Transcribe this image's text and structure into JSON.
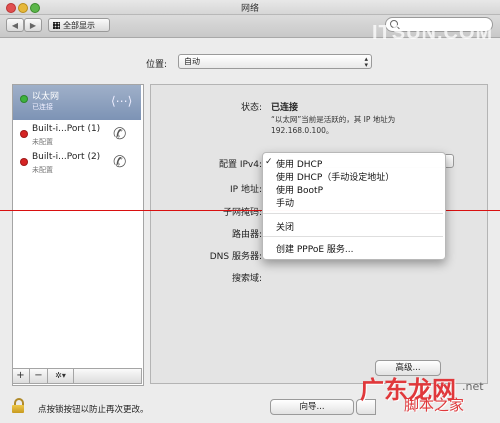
{
  "window": {
    "title": "网络"
  },
  "toolbar": {
    "back": "◀",
    "forward": "▶",
    "show_all": "全部显示",
    "search_placeholder": ""
  },
  "watermark": {
    "top": "ITSUN.COM",
    "logo": "广东龙网",
    "sub": "脚本之家",
    "net": ".net"
  },
  "location": {
    "label": "位置:",
    "value": "自动"
  },
  "services": [
    {
      "name": "以太网",
      "status": "已连接",
      "color": "#3db23d"
    },
    {
      "name": "Built-i...Port (1)",
      "status": "未配置",
      "color": "#d62424"
    },
    {
      "name": "Built-i...Port (2)",
      "status": "未配置",
      "color": "#d62424"
    }
  ],
  "sidebar_buttons": {
    "add": "+",
    "remove": "−",
    "gear": "✲▾"
  },
  "details": {
    "status_label": "状态:",
    "status_value": "已连接",
    "status_note": "“以太网”当前是活跃的，其 IP 地址为 192.168.0.100。",
    "config_label": "配置 IPv4:",
    "ip_label": "IP 地址:",
    "subnet_label": "子网掩码:",
    "router_label": "路由器:",
    "dns_label": "DNS 服务器:",
    "search_domain_label": "搜索域:",
    "advanced": "高级..."
  },
  "dropdown": {
    "check": "✓",
    "items": [
      "使用 DHCP",
      "使用 DHCP（手动设定地址）",
      "使用 BootP",
      "手动",
      "关闭",
      "创建 PPPoE 服务..."
    ]
  },
  "footer": {
    "lock_text": "点按锁按钮以防止再次更改。",
    "assistant": "向导..."
  },
  "colors": {
    "red_line": "#d91010",
    "selection": "#7d93b5"
  }
}
